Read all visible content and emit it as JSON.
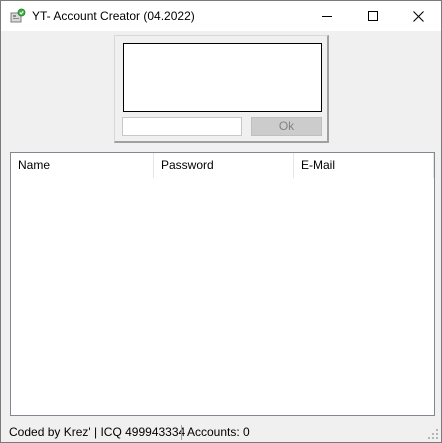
{
  "window": {
    "title": "YT- Account Creator (04.2022)",
    "icon": "app-icon",
    "controls": {
      "minimize_icon": "minimize-icon",
      "maximize_icon": "maximize-icon",
      "close_icon": "close-icon"
    }
  },
  "captcha": {
    "input_value": "",
    "ok_label": "Ok"
  },
  "accounts_list": {
    "columns": [
      "Name",
      "Password",
      "E-Mail"
    ],
    "rows": []
  },
  "statusbar": {
    "credits": "Coded by Krez' | ICQ 499943334",
    "accounts": "Accounts: 0"
  },
  "colors": {
    "window_bg": "#f0f0f0",
    "titlebar_bg": "#ffffff",
    "ok_disabled_bg": "#cccccc",
    "ok_disabled_text": "#838383"
  }
}
